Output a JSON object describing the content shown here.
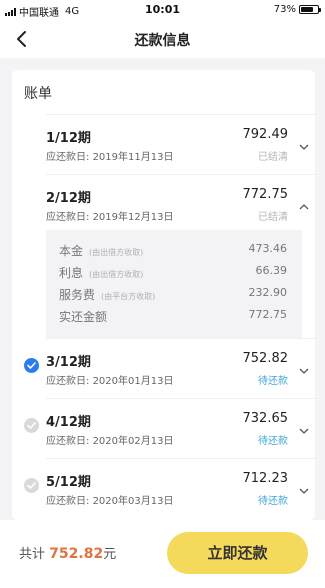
{
  "status_bar": {
    "carrier": "中国联通",
    "network": "4G",
    "time": "10:01",
    "battery_text": "73%",
    "battery_level": 0.73
  },
  "header": {
    "title": "还款信息"
  },
  "bill": {
    "title": "账单",
    "due_prefix": "应还款日: ",
    "items": [
      {
        "period": "1/12期",
        "due_date": "2019年11月13日",
        "amount": "792.49",
        "status": "已结清"
      },
      {
        "period": "2/12期",
        "due_date": "2019年12月13日",
        "amount": "772.75",
        "status": "已结清"
      },
      {
        "period": "3/12期",
        "due_date": "2020年01月13日",
        "amount": "752.82",
        "status": "待还款",
        "selected": true
      },
      {
        "period": "4/12期",
        "due_date": "2020年02月13日",
        "amount": "732.65",
        "status": "待还款"
      },
      {
        "period": "5/12期",
        "due_date": "2020年03月13日",
        "amount": "712.23",
        "status": "待还款"
      }
    ],
    "detail": [
      {
        "label": "本金",
        "note": "(由出借方收取)",
        "value": "473.46"
      },
      {
        "label": "利息",
        "note": "(由出借方收取)",
        "value": "66.39"
      },
      {
        "label": "服务费",
        "note": "(由平台方收取)",
        "value": "232.90"
      },
      {
        "label": "实还金额",
        "note": "",
        "value": "772.75"
      }
    ]
  },
  "footer": {
    "total_label": "共计",
    "total_amount": "752.82",
    "total_unit": "元",
    "pay_button": "立即还款"
  },
  "colors": {
    "accent_yellow": "#f4d95a",
    "pending_blue": "#3ea7d6",
    "total_orange": "#e0733f",
    "selected_blue": "#2b7cf0"
  }
}
